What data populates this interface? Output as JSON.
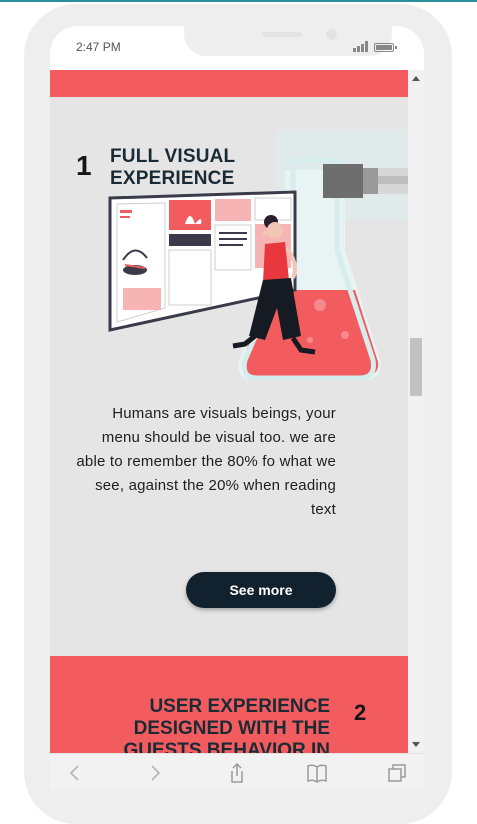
{
  "status_bar": {
    "time": "2:47 PM",
    "signal_icon": "signal-icon",
    "battery_icon": "battery-icon"
  },
  "section1": {
    "number": "1",
    "title_line1": "FULL VISUAL",
    "title_line2": "EXPERIENCE",
    "description": "Humans are visuals beings, your menu should be visual too. we are able to remember the 80% fo what we see, against the 20% when reading text",
    "button_label": "See more"
  },
  "section2": {
    "number": "2",
    "title_line1": "USER EXPERIENCE",
    "title_line2": "DESIGNED WITH THE",
    "title_line3": "GUESTS BEHAVIOR IN"
  },
  "browser_bar": {
    "icons": [
      "back-icon",
      "forward-icon",
      "share-icon",
      "bookmarks-icon",
      "tabs-icon"
    ]
  },
  "colors": {
    "accent_red": "#f25c5f",
    "dark_navy": "#11222e",
    "content_bg": "#e5e5e5",
    "phone_frame": "#eeeeee"
  }
}
